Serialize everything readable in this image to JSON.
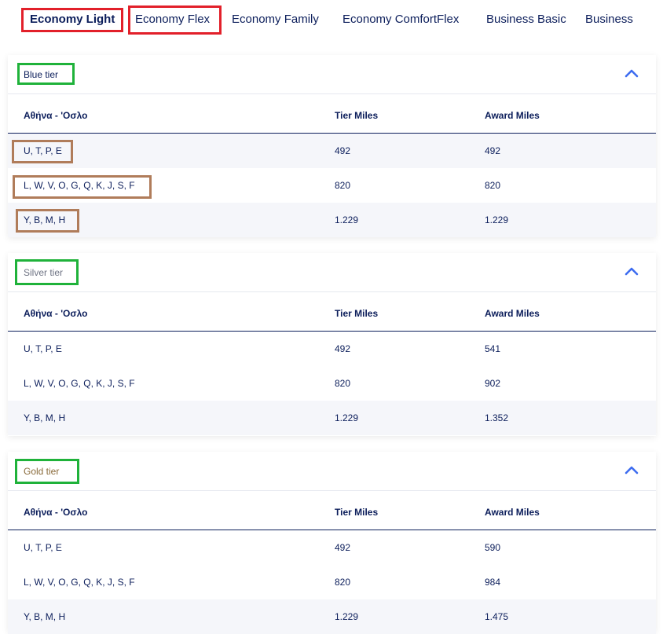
{
  "tabs": [
    {
      "label": "Economy Light",
      "active": true
    },
    {
      "label": "Economy Flex",
      "active": false
    },
    {
      "label": "Economy Family",
      "active": false
    },
    {
      "label": "Economy ComfortFlex",
      "active": false
    },
    {
      "label": "Business Basic",
      "active": false
    },
    {
      "label": "Business",
      "active": false
    }
  ],
  "colors": {
    "text": "#0c1e5b",
    "accent": "#3d6cf0",
    "highlight_red": "#e2202a",
    "highlight_green": "#1fb23a",
    "highlight_brown": "#b07c5a",
    "silver_label": "#6e7383",
    "gold_label": "#8a6b3b"
  },
  "columns": {
    "route": "Αθήνα - 'Οσλο",
    "tier_miles": "Tier Miles",
    "award_miles": "Award Miles"
  },
  "tiers": [
    {
      "label": "Blue tier",
      "chevron": "chevron-up-icon",
      "rows": [
        {
          "classes": "U, T, P, E",
          "tier_miles": "492",
          "award_miles": "492"
        },
        {
          "classes": "L, W, V, O, G, Q, K, J, S, F",
          "tier_miles": "820",
          "award_miles": "820"
        },
        {
          "classes": "Y, B, M, H",
          "tier_miles": "1.229",
          "award_miles": "1.229"
        }
      ]
    },
    {
      "label": "Silver tier",
      "chevron": "chevron-up-icon",
      "rows": [
        {
          "classes": "U, T, P, E",
          "tier_miles": "492",
          "award_miles": "541"
        },
        {
          "classes": "L, W, V, O, G, Q, K, J, S, F",
          "tier_miles": "820",
          "award_miles": "902"
        },
        {
          "classes": "Y, B, M, H",
          "tier_miles": "1.229",
          "award_miles": "1.352"
        }
      ]
    },
    {
      "label": "Gold tier",
      "chevron": "chevron-up-icon",
      "rows": [
        {
          "classes": "U, T, P, E",
          "tier_miles": "492",
          "award_miles": "590"
        },
        {
          "classes": "L, W, V, O, G, Q, K, J, S, F",
          "tier_miles": "820",
          "award_miles": "984"
        },
        {
          "classes": "Y, B, M, H",
          "tier_miles": "1.229",
          "award_miles": "1.475"
        }
      ]
    }
  ]
}
